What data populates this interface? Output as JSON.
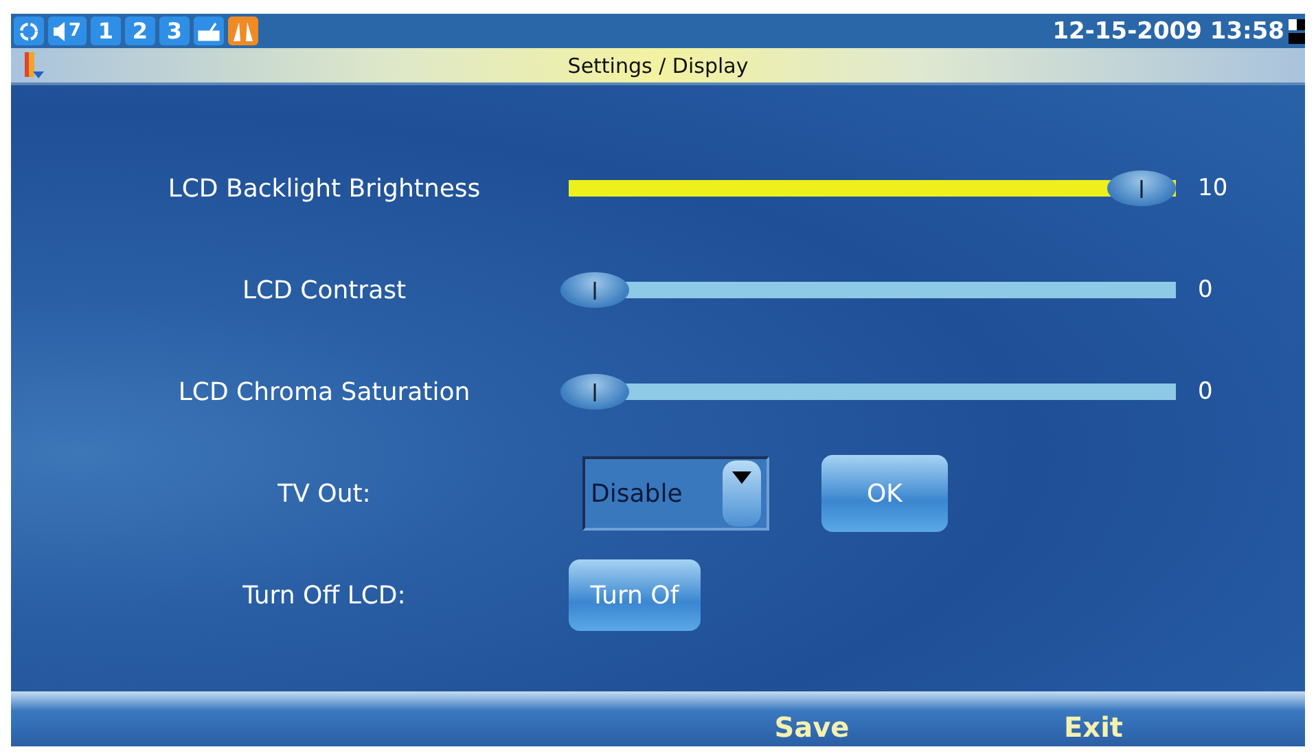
{
  "status_bar": {
    "volume": "7",
    "lines": [
      {
        "label": "1"
      },
      {
        "label": "2"
      },
      {
        "label": "3"
      }
    ],
    "datetime": "12-15-2009 13:58"
  },
  "title": "Settings / Display",
  "sliders": [
    {
      "label": "LCD Backlight Brightness",
      "level": 1,
      "reading": "10"
    },
    {
      "label": "LCD Contrast",
      "level": 0,
      "reading": "0"
    },
    {
      "label": "LCD Chroma Saturation",
      "level": 0,
      "reading": "0"
    }
  ],
  "tv_out": {
    "label": "TV Out:",
    "value": "Disable",
    "button": "OK"
  },
  "turn_off": {
    "label": "Turn Off LCD:",
    "button": "Turn Of"
  },
  "softkeys": [
    "Save",
    "Exit"
  ]
}
